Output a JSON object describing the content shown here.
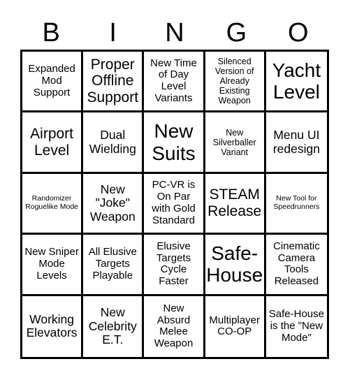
{
  "header": {
    "letters": [
      "B",
      "I",
      "N",
      "G",
      "O"
    ]
  },
  "board": {
    "cells": [
      [
        "Expanded Mod Support",
        "Proper Offline Support",
        "New Time of Day Level Variants",
        "Silenced Version of Already Existing Weapon",
        "Yacht Level"
      ],
      [
        "Airport Level",
        "Dual Wielding",
        "New Suits",
        "New Silverballer Variant",
        "Menu UI redesign"
      ],
      [
        "Randomizer Roguelike Mode",
        "New \"Joke\" Weapon",
        "PC-VR is On Par with Gold Standard",
        "STEAM Release",
        "New Tool for Speedrunners"
      ],
      [
        "New Sniper Mode Levels",
        "All Elusive Targets Playable",
        "Elusive Targets Cycle Faster",
        "Safe-House",
        "Cinematic Camera Tools Released"
      ],
      [
        "Working Elevators",
        "New Celebrity E.T.",
        "New Absurd Melee Weapon",
        "Multiplayer CO-OP",
        "Safe-House is the \"New Mode\""
      ]
    ]
  }
}
